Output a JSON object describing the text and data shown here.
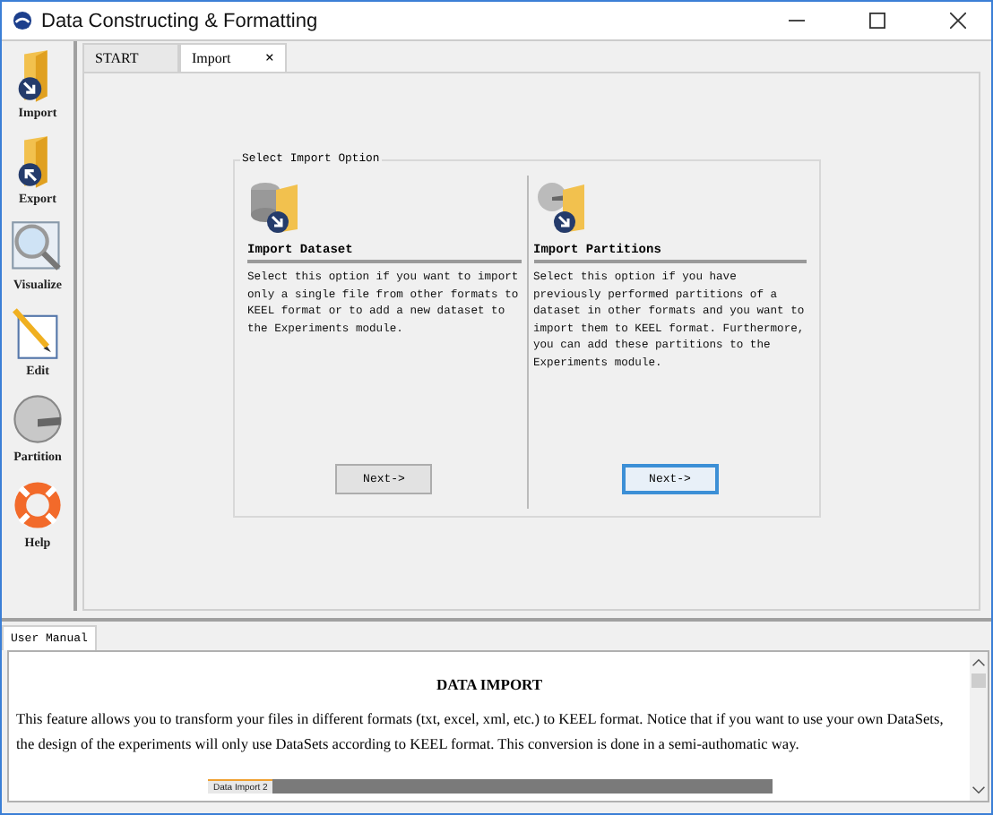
{
  "window": {
    "title": "Data Constructing & Formatting"
  },
  "sidebar": {
    "items": [
      {
        "label": "Import",
        "kind": "import"
      },
      {
        "label": "Export",
        "kind": "export"
      },
      {
        "label": "Visualize",
        "kind": "visualize"
      },
      {
        "label": "Edit",
        "kind": "edit"
      },
      {
        "label": "Partition",
        "kind": "partition"
      },
      {
        "label": "Help",
        "kind": "help"
      }
    ]
  },
  "tabs": [
    {
      "label": "START",
      "selected": false,
      "closable": false
    },
    {
      "label": "Import",
      "selected": true,
      "closable": true,
      "close": "×"
    }
  ],
  "import_panel": {
    "title": "Select Import Option",
    "options": [
      {
        "kind": "dataset",
        "heading": "Import Dataset",
        "text": "Select this option if you want to import only a single file from other formats to KEEL format or to add a new dataset to the Experiments module.",
        "button": "Next->",
        "focused": false
      },
      {
        "kind": "partitions",
        "heading": "Import Partitions",
        "text": "Select this option if you have previously performed partitions of a dataset in other formats and you want to import them to KEEL format. Furthermore, you can add these partitions to the Experiments module.",
        "button": "Next->",
        "focused": true
      }
    ]
  },
  "manual": {
    "tab": "User Manual",
    "heading": "DATA IMPORT",
    "paragraph": "This feature allows you to transform your files in different formats (txt, excel, xml, etc.) to KEEL format. Notice that if you want to use your own DataSets, the design of the experiments will only use DataSets according to KEEL format. This conversion is done in a semi-authomatic way."
  },
  "overlay_bar": {
    "label": "Data Import 2"
  }
}
